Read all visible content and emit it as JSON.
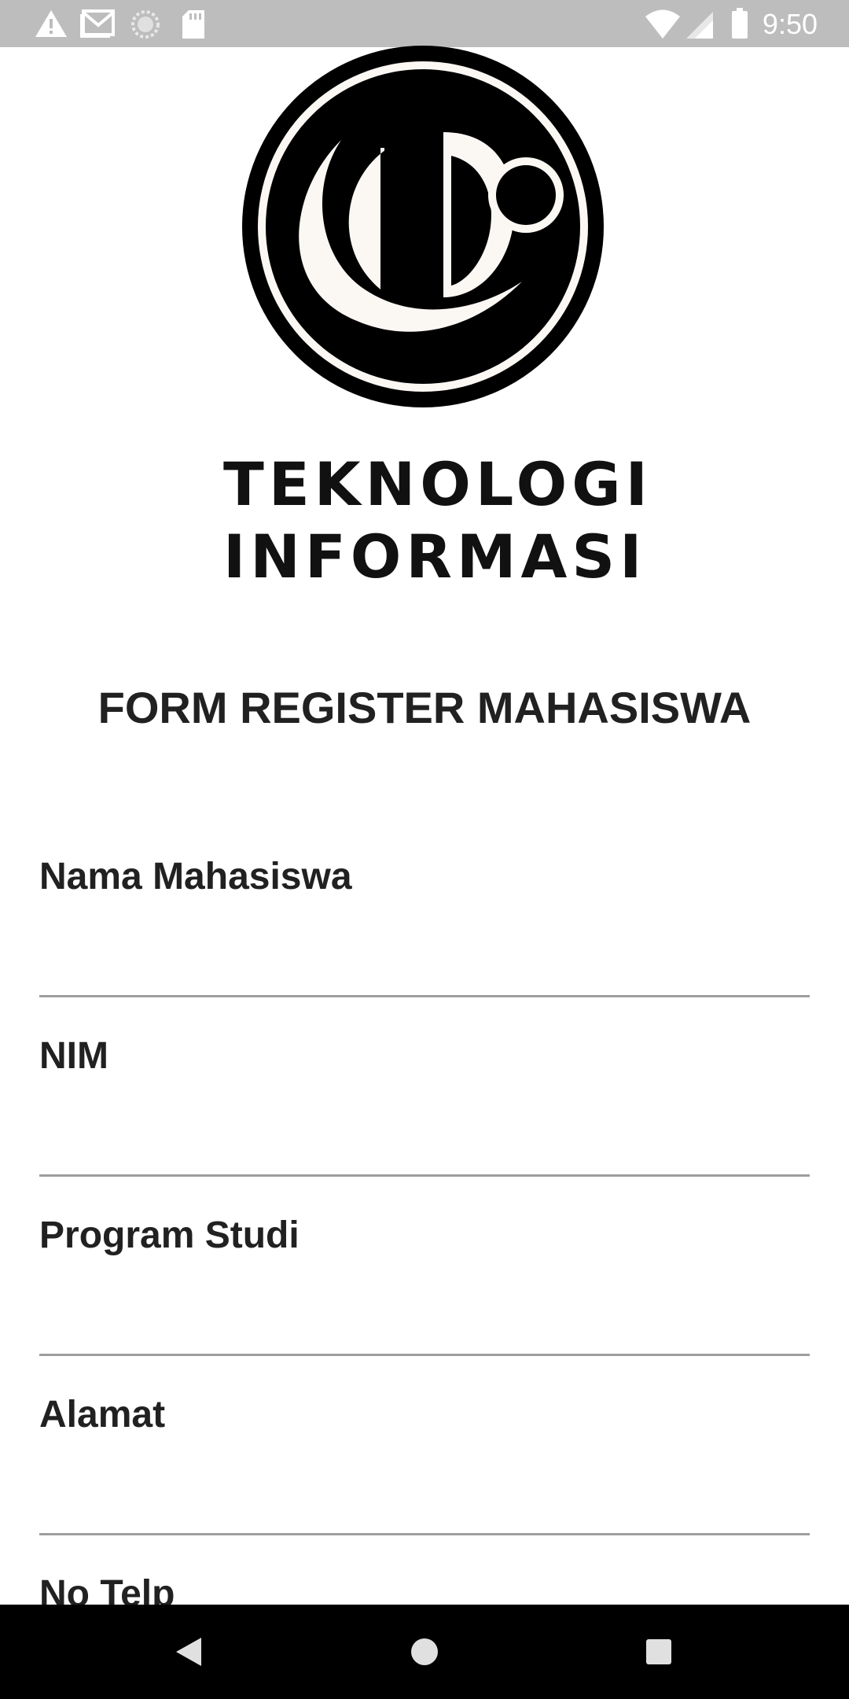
{
  "status_bar": {
    "time": "9:50",
    "left_icons": [
      "warning-icon",
      "gmail-icon",
      "sync-icon",
      "sd-card-icon"
    ],
    "right_icons": [
      "wifi-icon",
      "signal-icon",
      "battery-icon"
    ]
  },
  "logo": {
    "line1": "TEKNOLOGI",
    "line2": "INFORMASI"
  },
  "form": {
    "title": "FORM REGISTER MAHASISWA",
    "fields": [
      {
        "label": "Nama Mahasiswa",
        "value": ""
      },
      {
        "label": "NIM",
        "value": ""
      },
      {
        "label": "Program Studi",
        "value": ""
      },
      {
        "label": "Alamat",
        "value": ""
      },
      {
        "label": "No Telp",
        "value": ""
      }
    ]
  },
  "nav_bar": {
    "buttons": [
      "back-icon",
      "home-icon",
      "recents-icon"
    ]
  }
}
